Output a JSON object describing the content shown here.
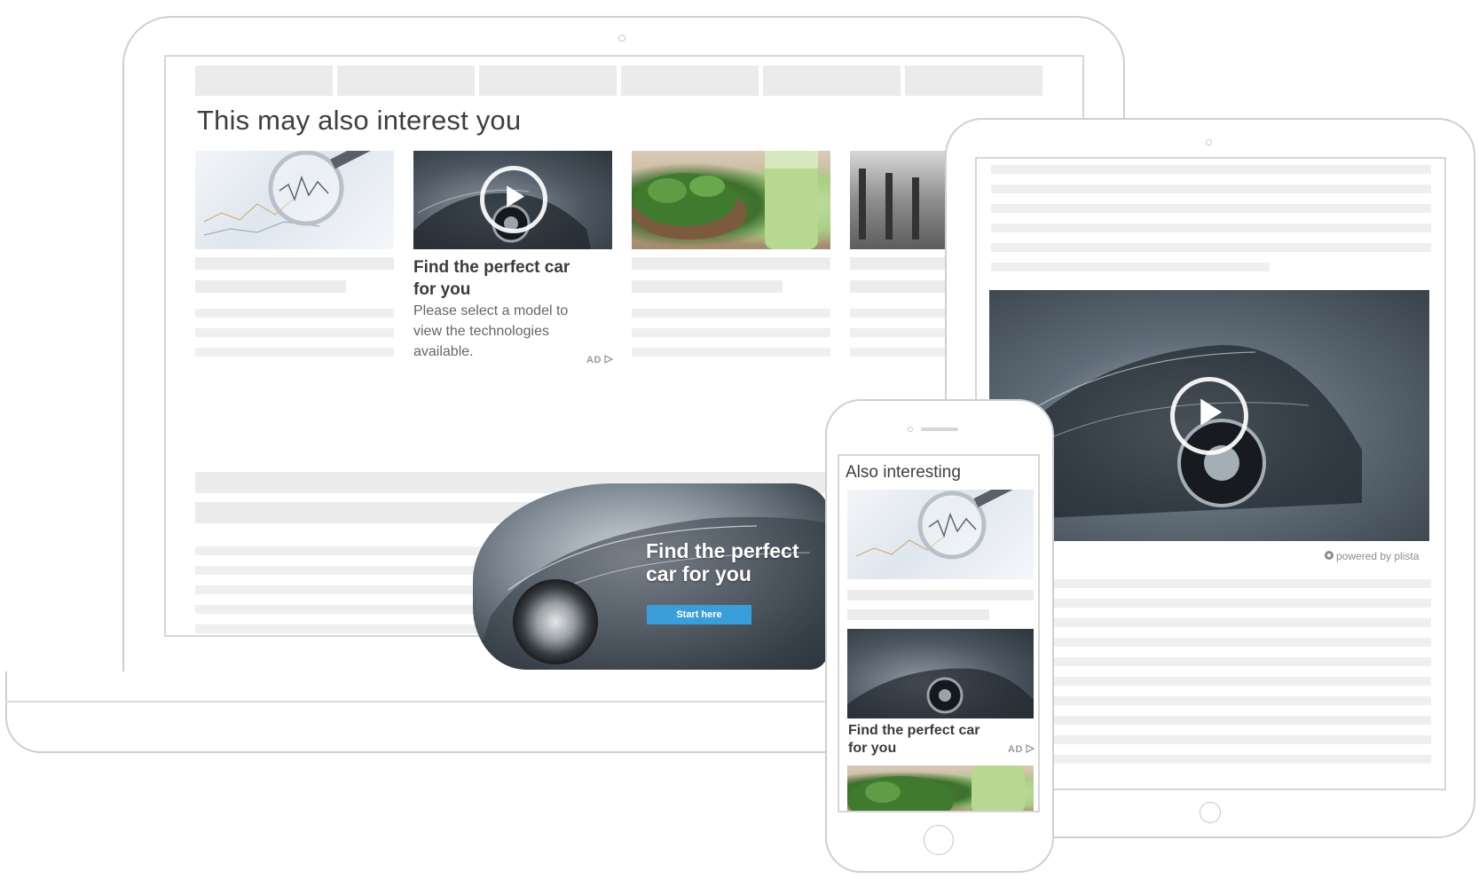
{
  "laptop": {
    "section_title": "This may also interest you",
    "cards": [
      {
        "image": "magnifier-chart-image"
      },
      {
        "image": "sports-car-video-thumbnail",
        "title_line1": "Find the perfect car",
        "title_line2": "for you",
        "desc_line1": "Please select a model to",
        "desc_line2": "view the technologies",
        "desc_line3": "available.",
        "ad_label": "AD"
      },
      {
        "image": "green-smoothie-salad-image"
      },
      {
        "image": "gym-treadmills-image"
      }
    ],
    "banner": {
      "title_line1": "Find the perfect",
      "title_line2": "car for you",
      "button_label": "Start here"
    }
  },
  "tablet": {
    "video_image": "sports-car-video",
    "powered_by": "powered by plista"
  },
  "phone": {
    "section_title": "Also interesting",
    "card_title_line1": "Find the perfect car",
    "card_title_line2": "for you",
    "ad_label": "AD"
  },
  "colors": {
    "button_blue": "#3a9fd8",
    "device_outline": "#cfcfcf",
    "placeholder_gray": "#ececec"
  },
  "icons": [
    "play-icon",
    "ad-choices-icon",
    "plista-logo-icon"
  ]
}
